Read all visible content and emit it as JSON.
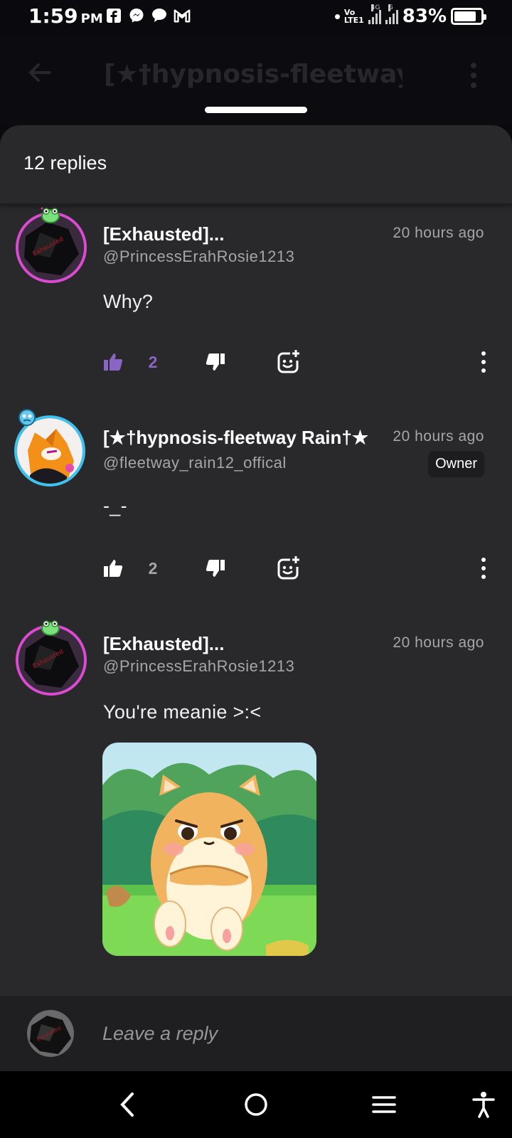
{
  "status_bar": {
    "time": "1:59",
    "ampm": "PM",
    "network_top": "Vo",
    "network_bottom": "LTE1",
    "signal1_label": "4G",
    "signal2_label": "G",
    "battery_percent": "83%",
    "battery_level": 0.83,
    "app_icons": [
      "facebook-icon",
      "messenger-icon",
      "chat-icon",
      "gmail-icon"
    ]
  },
  "app_bar": {
    "title": "[★†hypnosis-fleetway Ra"
  },
  "sheet": {
    "title": "12 replies"
  },
  "comments": [
    {
      "name": "[Exhausted]...",
      "handle": "@PrincessErahRosie1213",
      "time": "20 hours ago",
      "text": "Why?",
      "likes": "2",
      "liked": true,
      "avatar_ring": "#d94bd1"
    },
    {
      "name": "[★†hypnosis-fleetway Rain†★",
      "handle": "@fleetway_rain12_offical",
      "time": "20 hours ago",
      "badge": "Owner",
      "text": "-_-",
      "likes": "2",
      "liked": false,
      "avatar_ring": "#3ec3ee"
    },
    {
      "name": "[Exhausted]...",
      "handle": "@PrincessErahRosie1213",
      "time": "20 hours ago",
      "text": "You're meanie >:<",
      "has_sticker": true,
      "avatar_ring": "#d94bd1"
    }
  ],
  "reply": {
    "placeholder": "Leave a reply"
  },
  "colors": {
    "liked_accent": "#8a66c4",
    "sheet_bg": "#29292b",
    "muted_text": "#a6a6aa"
  }
}
